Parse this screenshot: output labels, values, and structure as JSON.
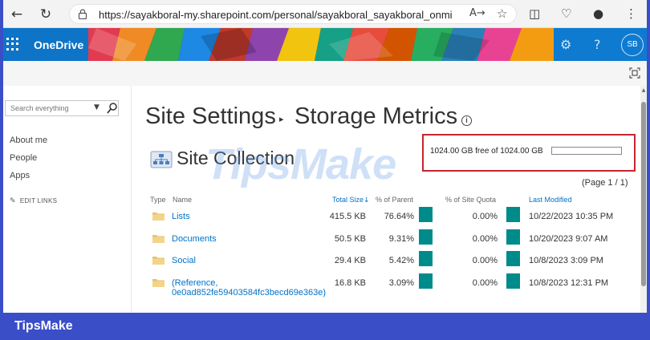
{
  "browser": {
    "url": "https://sayakboral-my.sharepoint.com/personal/sayakboral_sayakboral_onmicrosoft...",
    "read_aloud": "A→"
  },
  "suite": {
    "brand": "OneDrive",
    "avatar": "SB",
    "help": "?"
  },
  "nav": {
    "search_placeholder": "Search everything",
    "links": [
      "About me",
      "People",
      "Apps"
    ],
    "edit_links": "EDIT LINKS"
  },
  "page": {
    "title_part1": "Site Settings",
    "title_part2": "Storage Metrics",
    "section": "Site Collection",
    "quota_text": "1024.00 GB free of 1024.00 GB",
    "quota_used_fraction": 0,
    "pager": "(Page 1 / 1)"
  },
  "watermark": "TipsMake",
  "table": {
    "headers": {
      "type": "Type",
      "name": "Name",
      "total_size": "Total Size",
      "pct_parent": "% of Parent",
      "pct_quota": "% of Site Quota",
      "last_modified": "Last Modified"
    },
    "rows": [
      {
        "name": "Lists",
        "name2": "",
        "size": "415.5 KB",
        "pct_parent": "76.64%",
        "pct_quota": "0.00%",
        "modified": "10/22/2023 10:35 PM"
      },
      {
        "name": "Documents",
        "name2": "",
        "size": "50.5 KB",
        "pct_parent": "9.31%",
        "pct_quota": "0.00%",
        "modified": "10/20/2023 9:07 AM"
      },
      {
        "name": "Social",
        "name2": "",
        "size": "29.4 KB",
        "pct_parent": "5.42%",
        "pct_quota": "0.00%",
        "modified": "10/8/2023 3:09 PM"
      },
      {
        "name": "(Reference,",
        "name2": "0e0ad852fe59403584fc3becd69e363e)",
        "size": "16.8 KB",
        "pct_parent": "3.09%",
        "pct_quota": "0.00%",
        "modified": "10/8/2023 12:31 PM"
      }
    ]
  },
  "footer": {
    "brand": "TipsMake"
  },
  "colors": {
    "suite_blue": "#0d74c7",
    "frame_blue": "#3a4ec8",
    "link_blue": "#0072c6",
    "teal_block": "#008b8b",
    "highlight_red": "#c8242f"
  }
}
